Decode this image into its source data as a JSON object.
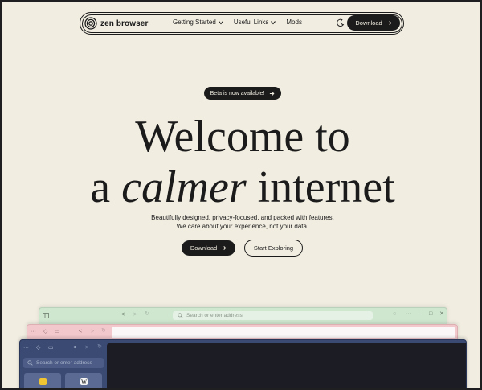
{
  "nav": {
    "brand": "zen browser",
    "links": [
      "Getting Started",
      "Useful Links",
      "Mods"
    ],
    "download_label": "Download"
  },
  "hero": {
    "beta_label": "Beta is now available!",
    "title_line1": "Welcome to",
    "title_line2_prefix": "a ",
    "title_line2_em": "calmer",
    "title_line2_suffix": " internet",
    "sub_line1": "Beautifully designed, privacy-focused, and packed with features.",
    "sub_line2": "We care about your experience, not your data.",
    "download_label": "Download",
    "explore_label": "Start Exploring"
  },
  "preview": {
    "address_placeholder": "Search or enter address",
    "blue_search_placeholder": "Search or enter address",
    "colors": {
      "green": "#cfe6cf",
      "pink": "#f2c8cc",
      "blue": "#3a4a72"
    }
  }
}
